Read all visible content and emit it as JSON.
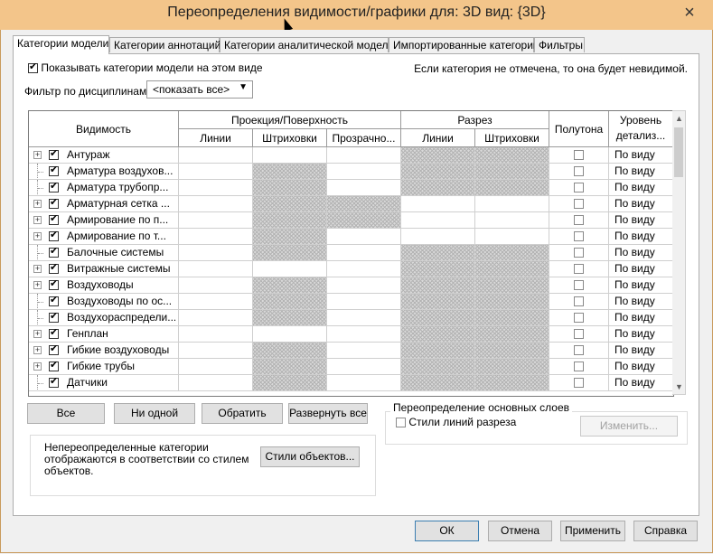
{
  "window": {
    "title": "Переопределения видимости/графики для: 3D вид: {3D}",
    "close_glyph": "×"
  },
  "tabs": [
    {
      "label": "Категории модели"
    },
    {
      "label": "Категории аннотаций"
    },
    {
      "label": "Категории аналитической модели"
    },
    {
      "label": "Импортированные категории"
    },
    {
      "label": "Фильтры"
    }
  ],
  "panel": {
    "show_categories_label": "Показывать категории модели на этом виде",
    "unchecked_note": "Если категория не отмечена, то она будет невидимой.",
    "filter_label": "Фильтр по дисциплинам:",
    "filter_value": "<показать все>"
  },
  "table": {
    "headers": {
      "visibility": "Видимость",
      "projection_group": "Проекция/Поверхность",
      "section_group": "Разрез",
      "halftone": "Полутона",
      "detail_level": "Уровень детализ...",
      "lines": "Линии",
      "patterns": "Штриховки",
      "transparency": "Прозрачно...",
      "sec_lines": "Линии",
      "sec_patterns": "Штриховки"
    },
    "rows": [
      {
        "name": "Антураж",
        "expand": true,
        "detail": "По виду",
        "hatch": [
          false,
          false,
          false,
          true,
          true
        ]
      },
      {
        "name": "Арматура воздухов...",
        "expand": false,
        "detail": "По виду",
        "hatch": [
          false,
          true,
          false,
          true,
          true
        ]
      },
      {
        "name": "Арматура трубопр...",
        "expand": false,
        "detail": "По виду",
        "hatch": [
          false,
          true,
          false,
          true,
          true
        ]
      },
      {
        "name": "Арматурная сетка ...",
        "expand": true,
        "detail": "По виду",
        "hatch": [
          false,
          true,
          true,
          false,
          false
        ]
      },
      {
        "name": "Армирование по п...",
        "expand": true,
        "detail": "По виду",
        "hatch": [
          false,
          true,
          true,
          false,
          false
        ]
      },
      {
        "name": "Армирование по т...",
        "expand": true,
        "detail": "По виду",
        "hatch": [
          false,
          true,
          false,
          false,
          false
        ]
      },
      {
        "name": "Балочные системы",
        "expand": false,
        "detail": "По виду",
        "hatch": [
          false,
          true,
          false,
          true,
          true
        ]
      },
      {
        "name": "Витражные системы",
        "expand": true,
        "detail": "По виду",
        "hatch": [
          false,
          false,
          false,
          true,
          true
        ]
      },
      {
        "name": "Воздуховоды",
        "expand": true,
        "detail": "По виду",
        "hatch": [
          false,
          true,
          false,
          true,
          true
        ]
      },
      {
        "name": "Воздуховоды по ос...",
        "expand": false,
        "detail": "По виду",
        "hatch": [
          false,
          true,
          false,
          true,
          true
        ]
      },
      {
        "name": "Воздухораспредели...",
        "expand": false,
        "detail": "По виду",
        "hatch": [
          false,
          true,
          false,
          true,
          true
        ]
      },
      {
        "name": "Генплан",
        "expand": true,
        "detail": "По виду",
        "hatch": [
          false,
          false,
          false,
          true,
          true
        ]
      },
      {
        "name": "Гибкие воздуховоды",
        "expand": true,
        "detail": "По виду",
        "hatch": [
          false,
          true,
          false,
          true,
          true
        ]
      },
      {
        "name": "Гибкие трубы",
        "expand": true,
        "detail": "По виду",
        "hatch": [
          false,
          true,
          false,
          true,
          true
        ]
      },
      {
        "name": "Датчики",
        "expand": false,
        "detail": "По виду",
        "hatch": [
          false,
          true,
          false,
          true,
          true
        ]
      }
    ]
  },
  "buttons": {
    "all": "Все",
    "none": "Ни одной",
    "invert": "Обратить",
    "expand_all": "Развернуть все"
  },
  "overrides": {
    "group_label": "Переопределение основных слоев",
    "cut_styles_label": "Стили линий разреза",
    "edit_button": "Изменить..."
  },
  "uncovered": {
    "text": "Непереопределенные категории отображаются в соответствии со стилем объектов.",
    "object_styles_button": "Стили объектов..."
  },
  "footer": {
    "ok": "ОК",
    "cancel": "Отмена",
    "apply": "Применить",
    "help": "Справка"
  }
}
